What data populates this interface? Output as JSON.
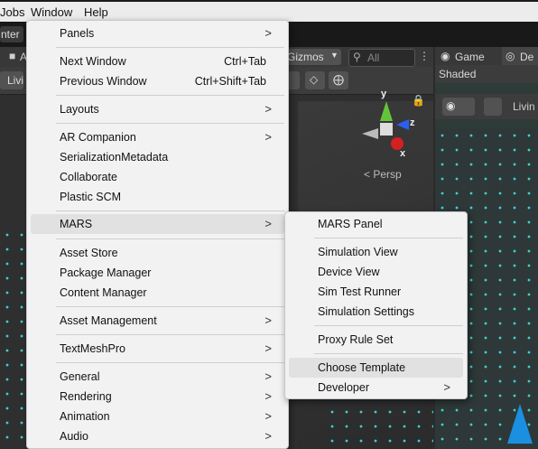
{
  "menubar": {
    "items": [
      "Jobs",
      "Window",
      "Help"
    ]
  },
  "editor": {
    "toolbar_text": "nter",
    "scene_tab": "A",
    "gizmos": "Gizmos",
    "search_placeholder": "All",
    "render_mode": "Livi",
    "axis_y": "y",
    "axis_z": "z",
    "axis_x": "x",
    "persp_label": "< Persp",
    "game_tab": "Game",
    "other_tab": "De",
    "shaded": "Shaded",
    "game_render_mode": "Livin"
  },
  "window_menu": {
    "items": [
      {
        "label": "Panels",
        "submenu": true
      },
      {
        "label": "Next Window",
        "shortcut": "Ctrl+Tab"
      },
      {
        "label": "Previous Window",
        "shortcut": "Ctrl+Shift+Tab"
      },
      {
        "label": "Layouts",
        "submenu": true
      },
      {
        "label": "AR Companion",
        "submenu": true
      },
      {
        "label": "SerializationMetadata"
      },
      {
        "label": "Collaborate"
      },
      {
        "label": "Plastic SCM"
      },
      {
        "label": "MARS",
        "submenu": true,
        "highlighted": true
      },
      {
        "label": "Asset Store"
      },
      {
        "label": "Package Manager"
      },
      {
        "label": "Content Manager"
      },
      {
        "label": "Asset Management",
        "submenu": true
      },
      {
        "label": "TextMeshPro",
        "submenu": true
      },
      {
        "label": "General",
        "submenu": true
      },
      {
        "label": "Rendering",
        "submenu": true
      },
      {
        "label": "Animation",
        "submenu": true
      },
      {
        "label": "Audio",
        "submenu": true
      }
    ]
  },
  "mars_menu": {
    "items": [
      {
        "label": "MARS Panel"
      },
      {
        "label": "Simulation View"
      },
      {
        "label": "Device View"
      },
      {
        "label": "Sim Test Runner"
      },
      {
        "label": "Simulation Settings"
      },
      {
        "label": "Proxy Rule Set"
      },
      {
        "label": "Choose Template",
        "highlighted": true
      },
      {
        "label": "Developer",
        "submenu": true
      }
    ]
  },
  "icons": {
    "submenu_arrow": ">"
  }
}
